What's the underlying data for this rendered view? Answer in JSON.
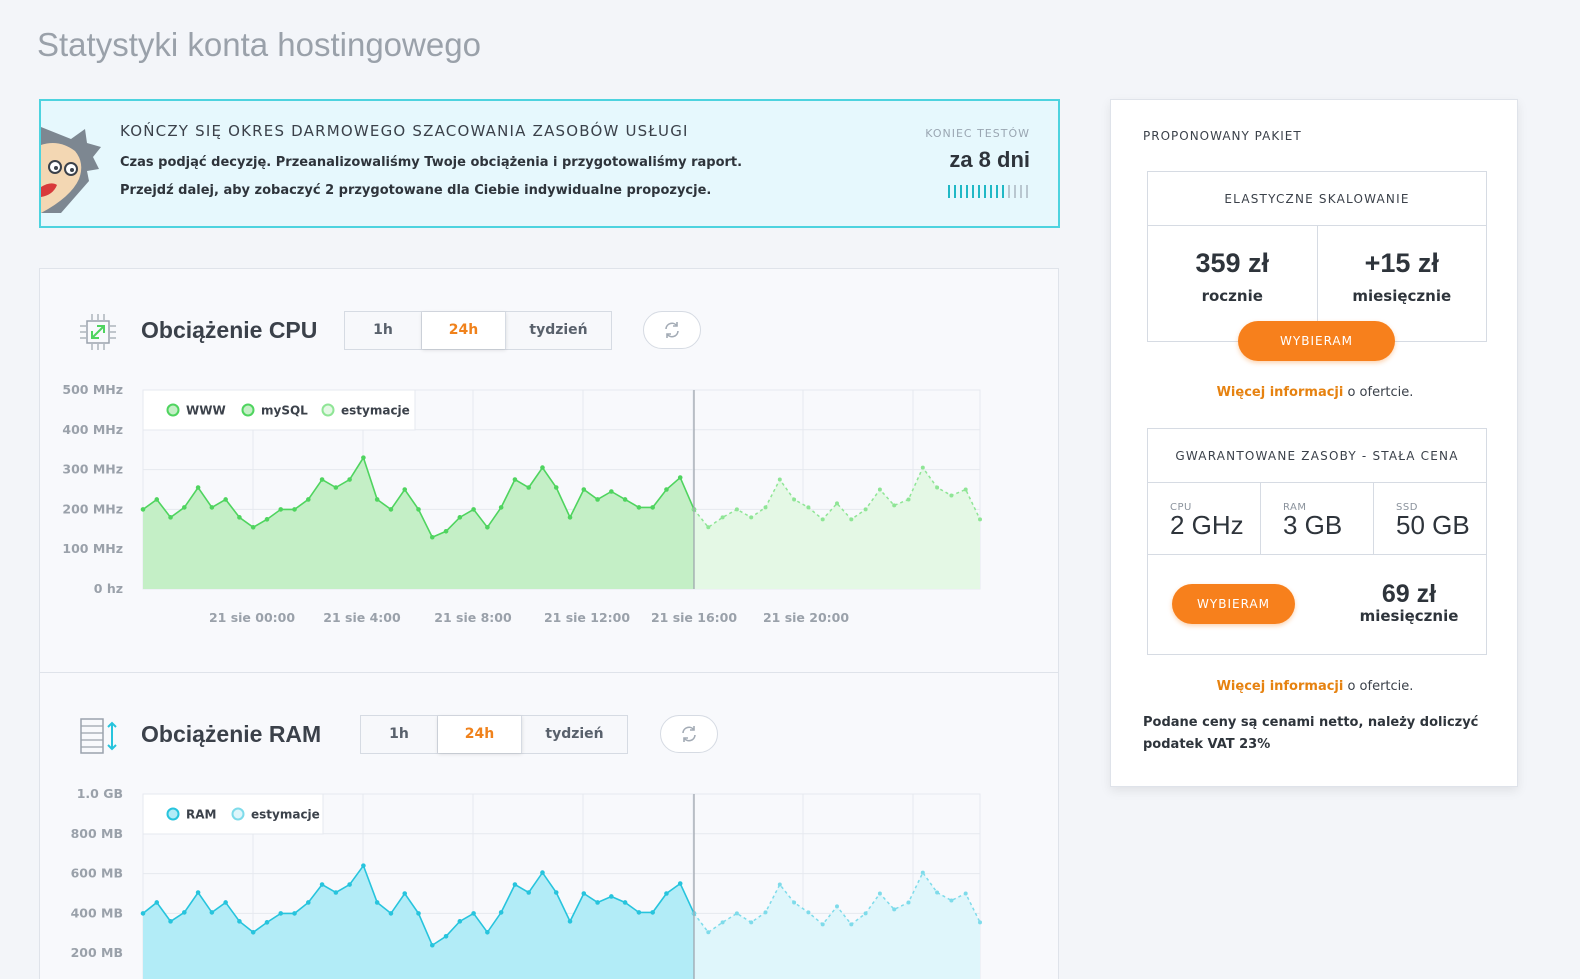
{
  "page": {
    "title": "Statystyki konta hostingowego"
  },
  "banner": {
    "heading": "KOŃCZY SIĘ OKRES DARMOWEGO SZACOWANIA ZASOBÓW USŁUGI",
    "line1": "Czas podjąć decyzję. Przeanalizowaliśmy Twoje obciążenia i przygotowaliśmy raport.",
    "line2": "Przejdź dalej, aby zobaczyć 2 przygotowane dla Ciebie indywidualne propozycje.",
    "end_label": "KONIEC TESTÓW",
    "days_left": "za 8 dni",
    "progress_ticks_total": 14,
    "progress_ticks_filled": 10,
    "accent": "#4dd3df"
  },
  "cpu": {
    "title": "Obciążenie CPU",
    "tabs": [
      "1h",
      "24h",
      "tydzień"
    ],
    "active_tab": "24h",
    "refresh_icon": "refresh-icon",
    "header_icon": "cpu-icon"
  },
  "ram": {
    "title": "Obciążenie RAM",
    "tabs": [
      "1h",
      "24h",
      "tydzień"
    ],
    "active_tab": "24h",
    "refresh_icon": "refresh-icon",
    "header_icon": "ram-icon"
  },
  "chart_data": [
    {
      "type": "area",
      "y_ticks": [
        "500 MHz",
        "400 MHz",
        "300 MHz",
        "200 MHz",
        "100 MHz",
        "0 hz"
      ],
      "x_ticks": [
        "21 sie 00:00",
        "21 sie 4:00",
        "21 sie 8:00",
        "21 sie 12:00",
        "21 sie 16:00",
        "21 sie 20:00"
      ],
      "ylim": [
        0,
        500
      ],
      "legend": [
        "WWW",
        "mySQL",
        "estymacje"
      ],
      "color": "#4fd45f",
      "fill": "#c4efc6",
      "est_fill": "#e4f8e5",
      "est_color": "#8fe596",
      "series": [
        {
          "name": "WWW",
          "values": [
            200,
            225,
            180,
            205,
            255,
            205,
            225,
            180,
            155,
            175,
            200,
            200,
            225,
            275,
            255,
            275,
            330,
            225,
            200,
            250,
            200,
            130,
            145,
            180,
            200,
            155,
            205,
            275,
            255,
            305,
            255,
            180,
            250,
            225,
            245,
            225,
            205,
            205,
            250,
            280,
            200
          ]
        },
        {
          "name": "estymacje",
          "values": [
            200,
            155,
            180,
            200,
            180,
            205,
            275,
            225,
            205,
            175,
            215,
            175,
            200,
            250,
            210,
            225,
            305,
            255,
            235,
            250,
            175
          ]
        }
      ]
    },
    {
      "type": "area",
      "y_ticks": [
        "1.0 GB",
        "800 MB",
        "600 MB",
        "400 MB",
        "200 MB"
      ],
      "ylim": [
        0,
        1000
      ],
      "legend": [
        "RAM",
        "estymacje"
      ],
      "color": "#27c4dd",
      "fill": "#b2ecf7",
      "est_fill": "#dff6fb",
      "est_color": "#7edbea",
      "series": [
        {
          "name": "RAM",
          "values": [
            400,
            455,
            360,
            405,
            505,
            405,
            455,
            360,
            305,
            355,
            400,
            400,
            455,
            545,
            505,
            545,
            640,
            455,
            400,
            500,
            400,
            240,
            285,
            360,
            400,
            305,
            405,
            545,
            505,
            605,
            505,
            360,
            500,
            455,
            485,
            455,
            405,
            405,
            500,
            550,
            400
          ]
        },
        {
          "name": "estymacje",
          "values": [
            400,
            305,
            355,
            400,
            355,
            405,
            545,
            455,
            405,
            345,
            435,
            345,
            400,
            500,
            420,
            455,
            605,
            505,
            465,
            500,
            355
          ]
        }
      ]
    }
  ],
  "side": {
    "title": "PROPONOWANY PAKIET",
    "elastic": {
      "heading": "ELASTYCZNE SKALOWANIE",
      "price_year": "359 zł",
      "price_year_label": "rocznie",
      "price_month": "+15 zł",
      "price_month_label": "miesięcznie",
      "button": "WYBIERAM"
    },
    "more_link": "Więcej informacji",
    "more_suffix": " o ofertcie.",
    "guaranteed": {
      "heading": "GWARANTOWANE ZASOBY - STAŁA CENA",
      "specs": [
        {
          "label": "CPU",
          "value": "2 GHz"
        },
        {
          "label": "RAM",
          "value": "3 GB"
        },
        {
          "label": "SSD",
          "value": "50 GB"
        }
      ],
      "button": "WYBIERAM",
      "price": "69 zł",
      "price_label": "miesięcznie"
    },
    "vat_note": "Podane ceny są cenami netto, należy doliczyć podatek VAT 23%",
    "button_color": "#f7801c",
    "link_color": "#e68210"
  }
}
